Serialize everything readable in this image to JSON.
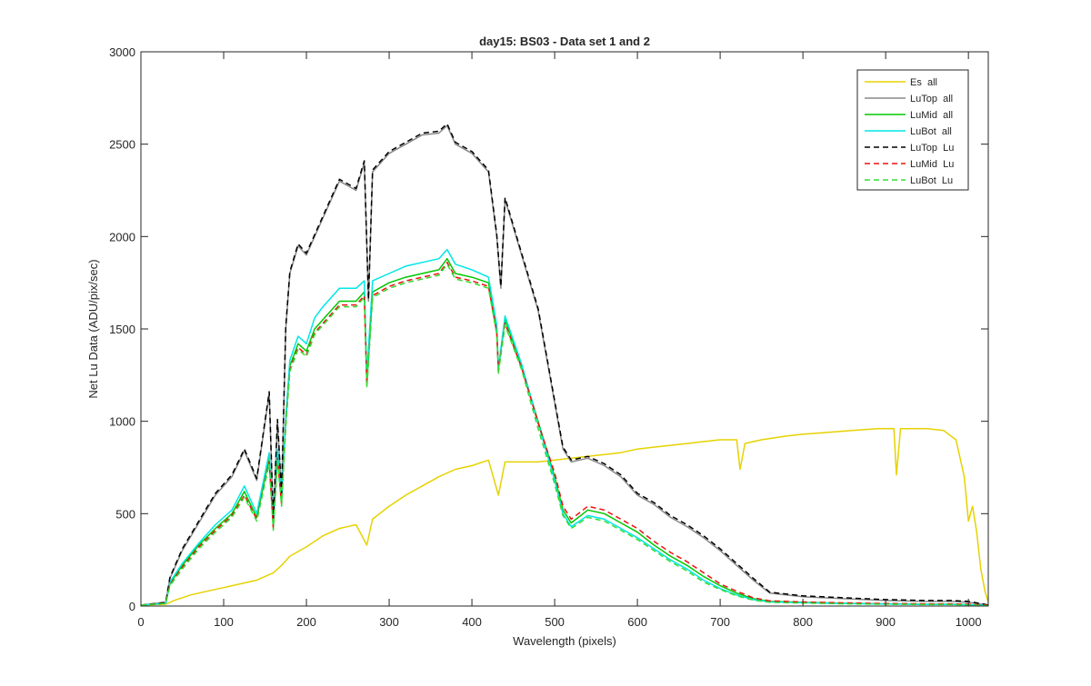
{
  "chart_data": {
    "type": "line",
    "title": "day15: BS03 - Data set 1 and 2",
    "xlabel": "Wavelength (pixels)",
    "ylabel": "Net Lu Data (ADU/pix/sec)",
    "xlim": [
      0,
      1024
    ],
    "ylim": [
      0,
      3000
    ],
    "xticks": [
      0,
      100,
      200,
      300,
      400,
      500,
      600,
      700,
      800,
      900,
      1000
    ],
    "yticks": [
      0,
      500,
      1000,
      1500,
      2000,
      2500,
      3000
    ],
    "grid": false,
    "legend_position": "top-right",
    "series": [
      {
        "name": "Es  all",
        "color": "#e6d200",
        "style": "solid",
        "x": [
          0,
          30,
          40,
          60,
          80,
          100,
          120,
          140,
          160,
          170,
          180,
          200,
          220,
          240,
          260,
          273,
          280,
          300,
          320,
          340,
          360,
          380,
          400,
          420,
          432,
          440,
          460,
          480,
          500,
          520,
          540,
          560,
          580,
          600,
          620,
          640,
          660,
          680,
          700,
          720,
          724,
          730,
          750,
          780,
          800,
          830,
          860,
          890,
          910,
          913,
          918,
          930,
          950,
          970,
          985,
          995,
          1000,
          1005,
          1010,
          1015,
          1020,
          1024
        ],
        "y": [
          5,
          10,
          30,
          60,
          80,
          100,
          120,
          140,
          180,
          220,
          270,
          320,
          380,
          420,
          440,
          330,
          470,
          540,
          600,
          650,
          700,
          740,
          760,
          790,
          600,
          780,
          780,
          780,
          790,
          800,
          810,
          820,
          830,
          850,
          860,
          870,
          880,
          890,
          900,
          900,
          740,
          880,
          900,
          920,
          930,
          940,
          950,
          960,
          960,
          710,
          960,
          960,
          960,
          950,
          900,
          700,
          460,
          540,
          400,
          200,
          80,
          20
        ]
      },
      {
        "name": "LuTop  all",
        "color": "#888888",
        "style": "solid",
        "x": [
          0,
          30,
          35,
          50,
          70,
          90,
          110,
          125,
          140,
          155,
          160,
          165,
          170,
          175,
          180,
          190,
          200,
          210,
          220,
          240,
          260,
          270,
          275,
          280,
          300,
          320,
          340,
          360,
          370,
          380,
          400,
          420,
          430,
          435,
          440,
          460,
          480,
          500,
          510,
          520,
          540,
          560,
          580,
          600,
          620,
          640,
          660,
          680,
          700,
          720,
          740,
          760,
          800,
          850,
          900,
          950,
          980,
          1000,
          1024
        ],
        "y": [
          5,
          20,
          150,
          300,
          450,
          600,
          700,
          840,
          680,
          1150,
          460,
          1000,
          600,
          1500,
          1800,
          1950,
          1900,
          2000,
          2100,
          2300,
          2250,
          2400,
          1650,
          2350,
          2450,
          2500,
          2550,
          2560,
          2600,
          2500,
          2450,
          2350,
          2000,
          1720,
          2200,
          1900,
          1600,
          1100,
          850,
          780,
          800,
          760,
          700,
          600,
          550,
          480,
          430,
          370,
          300,
          220,
          140,
          70,
          50,
          40,
          30,
          25,
          25,
          20,
          5
        ]
      },
      {
        "name": "LuMid  all",
        "color": "#00c800",
        "style": "solid",
        "x": [
          0,
          30,
          35,
          50,
          70,
          90,
          110,
          125,
          140,
          155,
          160,
          165,
          170,
          175,
          180,
          190,
          200,
          210,
          220,
          240,
          260,
          270,
          273,
          280,
          300,
          320,
          340,
          360,
          370,
          380,
          400,
          420,
          430,
          432,
          440,
          460,
          480,
          500,
          510,
          520,
          540,
          560,
          580,
          600,
          620,
          640,
          660,
          680,
          700,
          720,
          740,
          760,
          800,
          850,
          900,
          950,
          980,
          1000,
          1024
        ],
        "y": [
          5,
          15,
          120,
          220,
          330,
          420,
          500,
          620,
          480,
          800,
          430,
          820,
          560,
          1000,
          1300,
          1420,
          1380,
          1500,
          1550,
          1650,
          1650,
          1700,
          1200,
          1700,
          1750,
          1780,
          1800,
          1820,
          1880,
          1800,
          1780,
          1750,
          1500,
          1280,
          1550,
          1300,
          1000,
          700,
          520,
          450,
          520,
          500,
          450,
          400,
          330,
          270,
          220,
          160,
          110,
          70,
          40,
          25,
          20,
          15,
          12,
          10,
          10,
          8,
          3
        ]
      },
      {
        "name": "LuBot  all",
        "color": "#00e6e6",
        "style": "solid",
        "x": [
          0,
          30,
          35,
          50,
          70,
          90,
          110,
          125,
          140,
          155,
          160,
          165,
          170,
          175,
          180,
          190,
          200,
          210,
          220,
          240,
          260,
          270,
          273,
          280,
          300,
          320,
          340,
          360,
          370,
          380,
          400,
          420,
          430,
          432,
          440,
          460,
          480,
          500,
          510,
          520,
          540,
          560,
          580,
          600,
          620,
          640,
          660,
          680,
          700,
          720,
          740,
          760,
          800,
          850,
          900,
          950,
          980,
          1000,
          1024
        ],
        "y": [
          5,
          15,
          130,
          230,
          340,
          440,
          520,
          650,
          500,
          830,
          440,
          850,
          580,
          1020,
          1330,
          1460,
          1420,
          1560,
          1620,
          1720,
          1720,
          1760,
          1250,
          1760,
          1800,
          1840,
          1860,
          1880,
          1930,
          1850,
          1820,
          1780,
          1520,
          1290,
          1570,
          1310,
          990,
          680,
          500,
          430,
          490,
          470,
          420,
          370,
          310,
          250,
          200,
          140,
          95,
          60,
          35,
          22,
          18,
          14,
          11,
          9,
          9,
          7,
          3
        ]
      },
      {
        "name": "LuTop  Lu",
        "color": "#000000",
        "style": "dashed",
        "x": [
          0,
          30,
          35,
          50,
          70,
          90,
          110,
          125,
          140,
          155,
          160,
          165,
          170,
          175,
          180,
          190,
          200,
          210,
          220,
          240,
          260,
          270,
          275,
          280,
          300,
          320,
          340,
          360,
          370,
          380,
          400,
          420,
          430,
          435,
          440,
          460,
          480,
          500,
          510,
          520,
          540,
          560,
          580,
          600,
          620,
          640,
          660,
          680,
          700,
          720,
          740,
          760,
          800,
          850,
          900,
          950,
          980,
          1000,
          1024
        ],
        "y": [
          5,
          20,
          155,
          310,
          460,
          610,
          710,
          850,
          690,
          1160,
          470,
          1010,
          610,
          1510,
          1810,
          1960,
          1910,
          2010,
          2110,
          2310,
          2260,
          2410,
          1660,
          2360,
          2460,
          2510,
          2560,
          2570,
          2610,
          2510,
          2460,
          2360,
          2010,
          1730,
          2210,
          1910,
          1610,
          1110,
          860,
          790,
          810,
          770,
          710,
          610,
          560,
          490,
          440,
          380,
          310,
          230,
          150,
          75,
          55,
          45,
          35,
          30,
          30,
          25,
          6
        ]
      },
      {
        "name": "LuMid  Lu",
        "color": "#ee1111",
        "style": "dashed",
        "x": [
          0,
          30,
          35,
          50,
          70,
          90,
          110,
          125,
          140,
          155,
          160,
          165,
          170,
          175,
          180,
          190,
          200,
          210,
          220,
          240,
          260,
          270,
          273,
          280,
          300,
          320,
          340,
          360,
          370,
          380,
          400,
          420,
          430,
          432,
          440,
          460,
          480,
          500,
          510,
          520,
          540,
          560,
          580,
          600,
          620,
          640,
          660,
          680,
          700,
          720,
          740,
          760,
          800,
          850,
          900,
          950,
          980,
          1000,
          1024
        ],
        "y": [
          5,
          15,
          115,
          210,
          320,
          410,
          490,
          600,
          470,
          780,
          420,
          800,
          550,
          980,
          1280,
          1400,
          1360,
          1480,
          1530,
          1630,
          1630,
          1680,
          1190,
          1680,
          1730,
          1760,
          1780,
          1800,
          1860,
          1780,
          1760,
          1730,
          1480,
          1270,
          1530,
          1290,
          990,
          720,
          540,
          470,
          540,
          520,
          470,
          420,
          350,
          290,
          240,
          180,
          120,
          80,
          45,
          28,
          22,
          17,
          14,
          12,
          12,
          10,
          4
        ]
      },
      {
        "name": "LuBot  Lu",
        "color": "#33dd33",
        "style": "dashed",
        "x": [
          0,
          30,
          35,
          50,
          70,
          90,
          110,
          125,
          140,
          155,
          160,
          165,
          170,
          175,
          180,
          190,
          200,
          210,
          220,
          240,
          260,
          270,
          273,
          280,
          300,
          320,
          340,
          360,
          370,
          380,
          400,
          420,
          430,
          432,
          440,
          460,
          480,
          500,
          510,
          520,
          540,
          560,
          580,
          600,
          620,
          640,
          660,
          680,
          700,
          720,
          740,
          760,
          800,
          850,
          900,
          950,
          980,
          1000,
          1024
        ],
        "y": [
          5,
          15,
          110,
          200,
          310,
          400,
          480,
          590,
          460,
          770,
          410,
          790,
          540,
          970,
          1270,
          1390,
          1350,
          1470,
          1520,
          1620,
          1620,
          1670,
          1180,
          1670,
          1720,
          1750,
          1770,
          1790,
          1850,
          1770,
          1750,
          1720,
          1470,
          1260,
          1520,
          1280,
          960,
          660,
          490,
          420,
          480,
          460,
          410,
          360,
          300,
          240,
          190,
          130,
          90,
          55,
          32,
          20,
          16,
          12,
          10,
          8,
          8,
          6,
          2
        ]
      }
    ]
  }
}
